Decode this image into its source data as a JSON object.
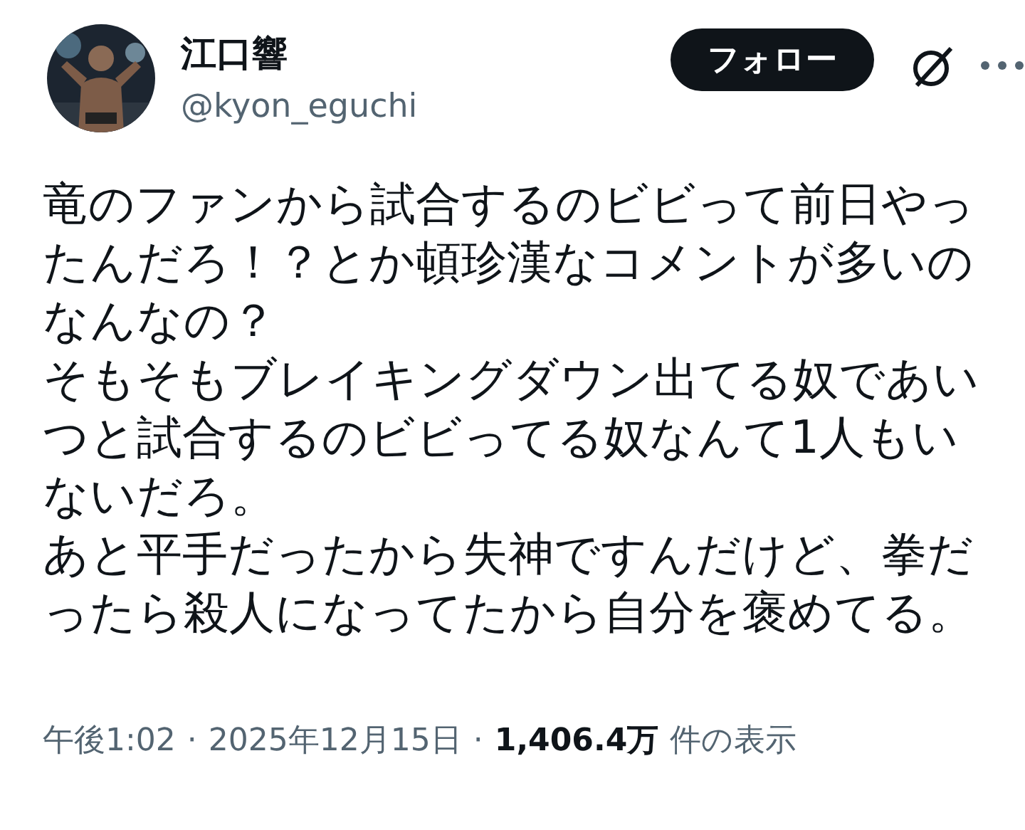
{
  "author": {
    "name": "江口響",
    "handle": "@kyon_eguchi"
  },
  "follow_button": "フォロー",
  "paragraphs": [
    "竜のファンから試合するのビビって前日やったんだろ！？とか頓珍漢なコメントが多いのなんなの？",
    "そもそもブレイキングダウン出てる奴であいつと試合するのビビってる奴なんて1人もいないだろ。",
    "あと平手だったから失神ですんだけど、拳だったら殺人になってたから自分を褒めてる。"
  ],
  "meta": {
    "time": "午後1:02",
    "separator": "·",
    "date": "2025年12月15日",
    "views_count": "1,406.4万",
    "views_label": "件の表示"
  }
}
